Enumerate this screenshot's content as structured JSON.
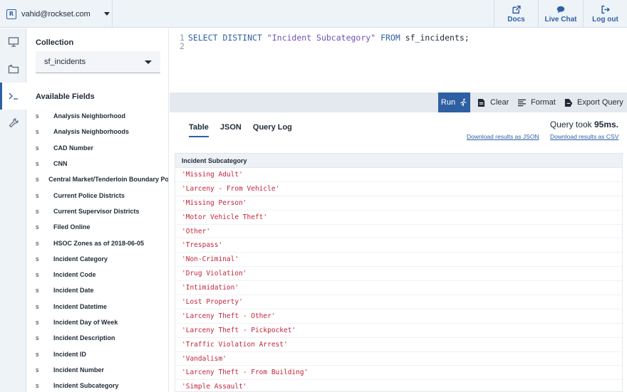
{
  "account": {
    "email": "vahid@rockset.com",
    "logo": "R"
  },
  "topbar": {
    "docs_label": "Docs",
    "chat_label": "Live Chat",
    "logout_label": "Log out"
  },
  "rail": {
    "icons": [
      "monitor-icon",
      "folder-icon",
      "console-icon",
      "wrench-icon"
    ],
    "active": "console-icon"
  },
  "collection": {
    "title": "Collection",
    "selected": "sf_incidents"
  },
  "fields": {
    "title": "Available Fields",
    "items": [
      {
        "type": "s",
        "name": "Analysis Neighborhood"
      },
      {
        "type": "s",
        "name": "Analysis Neighborhoods"
      },
      {
        "type": "s",
        "name": "CAD Number"
      },
      {
        "type": "s",
        "name": "CNN"
      },
      {
        "type": "s",
        "name": "Central Market/Tenderloin Boundary Po"
      },
      {
        "type": "s",
        "name": "Current Police Districts"
      },
      {
        "type": "s",
        "name": "Current Supervisor Districts"
      },
      {
        "type": "s",
        "name": "Filed Online"
      },
      {
        "type": "s",
        "name": "HSOC Zones as of 2018-06-05"
      },
      {
        "type": "s",
        "name": "Incident Category"
      },
      {
        "type": "s",
        "name": "Incident Code"
      },
      {
        "type": "s",
        "name": "Incident Date"
      },
      {
        "type": "s",
        "name": "Incident Datetime"
      },
      {
        "type": "s",
        "name": "Incident Day of Week"
      },
      {
        "type": "s",
        "name": "Incident Description"
      },
      {
        "type": "s",
        "name": "Incident ID"
      },
      {
        "type": "s",
        "name": "Incident Number"
      },
      {
        "type": "s",
        "name": "Incident Subcategory"
      }
    ]
  },
  "editor": {
    "line1_no": "1",
    "line2_no": "2",
    "kw_select": "SELECT DISTINCT",
    "str_field": "\"Incident Subcategory\"",
    "kw_from": "FROM",
    "table_name": "sf_incidents;"
  },
  "toolbar": {
    "run_label": "Run",
    "clear_label": "Clear",
    "format_label": "Format",
    "export_label": "Export Query"
  },
  "results": {
    "tabs": [
      "Table",
      "JSON",
      "Query Log"
    ],
    "active_tab": "Table",
    "query_took_prefix": "Query took",
    "query_took_value": "95ms.",
    "download_json": "Download results as JSON",
    "download_csv": "Download results as CSV",
    "column": "Incident Subcategory",
    "rows": [
      "'Missing Adult'",
      "'Larceny - From Vehicle'",
      "'Missing Person'",
      "'Motor Vehicle Theft'",
      "'Other'",
      "'Trespass'",
      "'Non-Criminal'",
      "'Drug Violation'",
      "'Intimidation'",
      "'Lost Property'",
      "'Larceny Theft - Other'",
      "'Larceny Theft - Pickpocket'",
      "'Traffic Violation Arrest'",
      "'Vandalism'",
      "'Larceny Theft - From Building'",
      "'Simple Assault'"
    ]
  },
  "colors": {
    "accent": "#2f5fa3",
    "value_red": "#c2243a",
    "topbar_bg": "#eef3f8"
  }
}
